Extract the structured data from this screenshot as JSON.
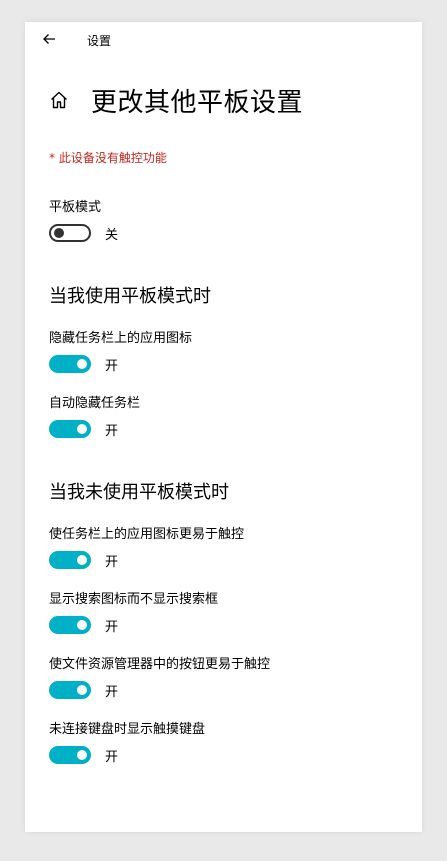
{
  "app": {
    "title": "设置"
  },
  "header": {
    "title": "更改其他平板设置"
  },
  "warning": "* 此设备没有触控功能",
  "tablet_mode": {
    "label": "平板模式",
    "state": "关",
    "on": false
  },
  "section_using": {
    "heading": "当我使用平板模式时",
    "settings": [
      {
        "label": "隐藏任务栏上的应用图标",
        "state": "开",
        "on": true
      },
      {
        "label": "自动隐藏任务栏",
        "state": "开",
        "on": true
      }
    ]
  },
  "section_not_using": {
    "heading": "当我未使用平板模式时",
    "settings": [
      {
        "label": "使任务栏上的应用图标更易于触控",
        "state": "开",
        "on": true
      },
      {
        "label": "显示搜索图标而不显示搜索框",
        "state": "开",
        "on": true
      },
      {
        "label": "使文件资源管理器中的按钮更易于触控",
        "state": "开",
        "on": true
      },
      {
        "label": "未连接键盘时显示触摸键盘",
        "state": "开",
        "on": true
      }
    ]
  },
  "colors": {
    "accent": "#00b0c6",
    "warning": "#c4261d"
  },
  "icons": {
    "back": "arrow-left",
    "home": "home"
  }
}
